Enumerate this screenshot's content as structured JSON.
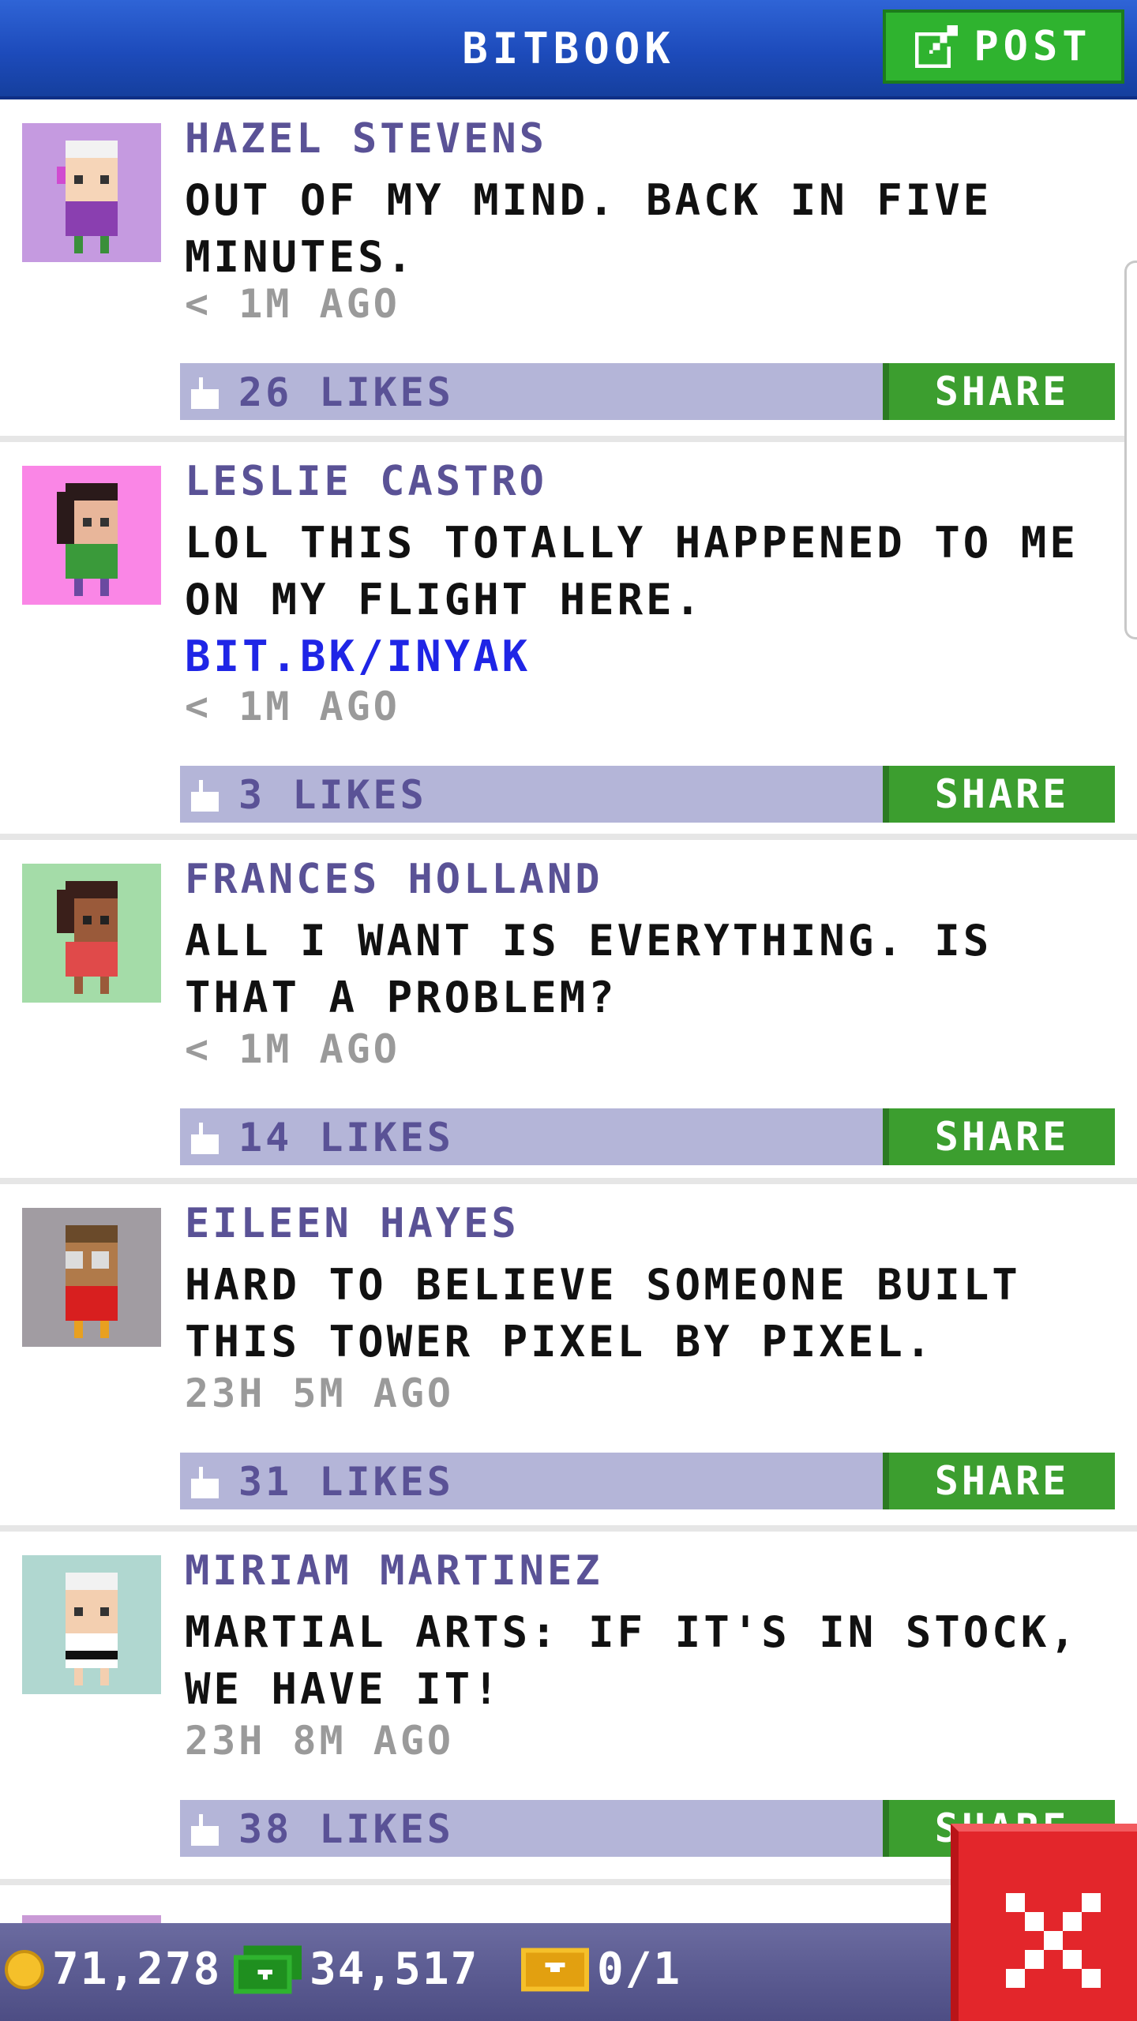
{
  "header": {
    "title": "BITBOOK",
    "post_label": "POST"
  },
  "posts": [
    {
      "author": "HAZEL STEVENS",
      "text": "OUT OF MY MIND. BACK IN FIVE MINUTES.",
      "link": "",
      "time": "< 1M AGO",
      "likes": "26 LIKES",
      "share_label": "SHARE",
      "avatar_bg": "#c59ae0"
    },
    {
      "author": "LESLIE CASTRO",
      "text": "LOL THIS TOTALLY HAPPENED TO ME ON MY FLIGHT HERE.",
      "link": "BIT.BK/INYAK",
      "time": "< 1M AGO",
      "likes": "3 LIKES",
      "share_label": "SHARE",
      "avatar_bg": "#fa86e6"
    },
    {
      "author": "FRANCES HOLLAND",
      "text": "ALL I WANT IS EVERYTHING. IS THAT A PROBLEM?",
      "link": "",
      "time": "< 1M AGO",
      "likes": "14 LIKES",
      "share_label": "SHARE",
      "avatar_bg": "#a4dca8"
    },
    {
      "author": "EILEEN HAYES",
      "text": "HARD TO BELIEVE SOMEONE BUILT THIS TOWER PIXEL BY PIXEL.",
      "link": "",
      "time": "23H 5M AGO",
      "likes": "31 LIKES",
      "share_label": "SHARE",
      "avatar_bg": "#a19ca2"
    },
    {
      "author": "MIRIAM MARTINEZ",
      "text": "MARTIAL ARTS: IF IT'S IN STOCK, WE HAVE IT!",
      "link": "",
      "time": "23H 8M AGO",
      "likes": "38 LIKES",
      "share_label": "SHARE",
      "avatar_bg": "#b0d7d0"
    }
  ],
  "bottom_bar": {
    "coins": "71,278",
    "bux": "34,517",
    "tickets": "0/1"
  },
  "colors": {
    "header_blue": "#1d4bbb",
    "post_green": "#2fb32f",
    "share_green": "#3c9e2f",
    "likes_bar": "#b4b5d8",
    "author_purple": "#5a5296",
    "link_blue": "#1f25e6",
    "close_red": "#e3262b"
  }
}
